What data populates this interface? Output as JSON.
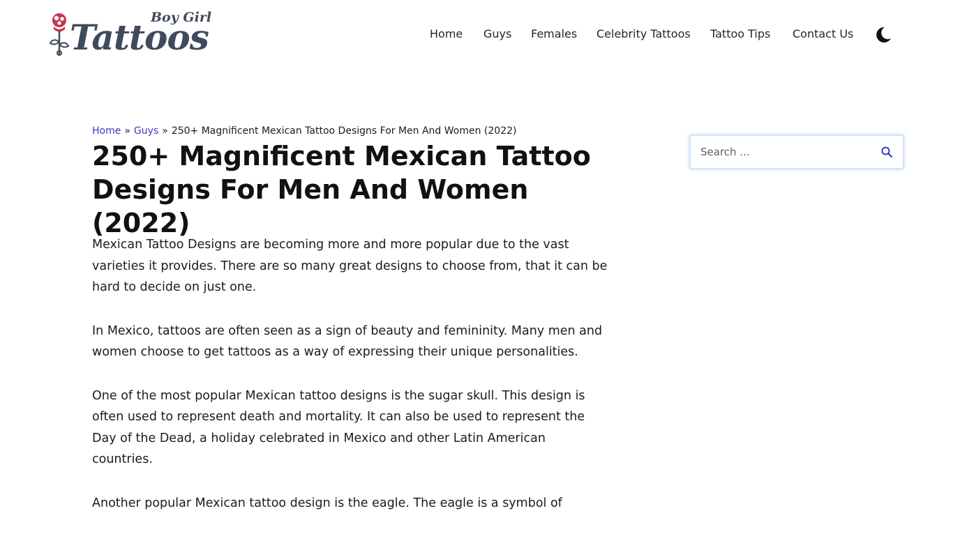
{
  "site": {
    "logo_main": "Tattoos",
    "logo_sub": "Boy Girl",
    "logo_color": "#3f4a5d",
    "rose_color": "#c8354e"
  },
  "nav": {
    "items": [
      {
        "label": "Home"
      },
      {
        "label": "Guys"
      },
      {
        "label": "Females"
      },
      {
        "label": "Celebrity Tattoos"
      },
      {
        "label": "Tattoo Tips"
      },
      {
        "label": "Contact Us"
      }
    ],
    "theme_toggle_icon": "moon-icon"
  },
  "breadcrumb": {
    "home": "Home",
    "separator": "»",
    "category": "Guys",
    "current": "250+ Magnificent Mexican Tattoo Designs For Men And Women (2022)"
  },
  "article": {
    "title": "250+ Magnificent Mexican Tattoo Designs For Men And Women (2022)",
    "paragraphs": [
      "Mexican Tattoo Designs are becoming more and more popular due to the vast varieties it provides. There are so many great designs to choose from, that it can be hard to decide on just one.",
      "In Mexico, tattoos are often seen as a sign of beauty and femininity. Many men and women choose to get tattoos as a way of expressing their unique personalities.",
      "One of the most popular Mexican tattoo designs is the sugar skull. This design is often used to represent death and mortality. It can also be used to represent the Day of the Dead, a holiday celebrated in Mexico and other Latin American countries.",
      "Another popular Mexican tattoo design is the eagle. The eagle is a symbol of"
    ]
  },
  "sidebar": {
    "search": {
      "placeholder": "Search ...",
      "icon": "search-icon",
      "accent": "#3b37c7"
    }
  },
  "colors": {
    "link": "#3b37c7",
    "text": "#1c1c1c"
  }
}
